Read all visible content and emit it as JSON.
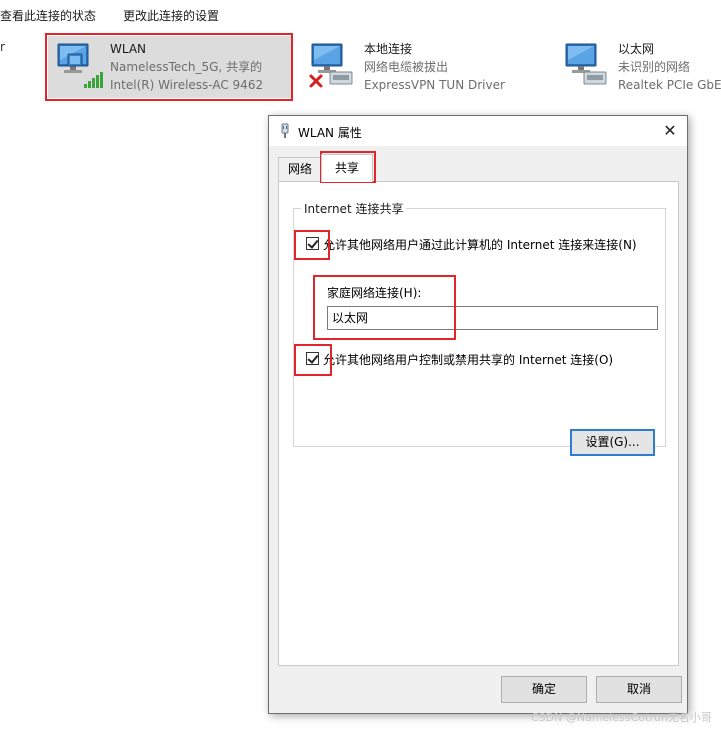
{
  "command_bar": {
    "view_status": "查看此连接的状态",
    "change_settings": "更改此连接的设置"
  },
  "left_cut_text": "r",
  "adapters": [
    {
      "name": "WLAN",
      "line1": "NamelessTech_5G, 共享的",
      "line2": "Intel(R) Wireless-AC 9462",
      "icon": "wifi-adapter-icon",
      "selected": true
    },
    {
      "name": "本地连接",
      "line1": "网络电缆被拔出",
      "line2": "ExpressVPN TUN Driver",
      "icon": "ethernet-disconnected-icon",
      "selected": false
    },
    {
      "name": "以太网",
      "line1": "未识别的网络",
      "line2": "Realtek PCIe GbE I",
      "icon": "ethernet-adapter-icon",
      "selected": false
    }
  ],
  "dialog": {
    "title": "WLAN 属性",
    "tabs": [
      {
        "label": "网络",
        "active": false
      },
      {
        "label": "共享",
        "active": true
      }
    ],
    "group_title": "Internet 连接共享",
    "allow_connect_label": "允许其他网络用户通过此计算机的 Internet 连接来连接(N)",
    "allow_connect_checked": true,
    "home_network_label": "家庭网络连接(H):",
    "home_network_value": "以太网",
    "allow_control_label": "允许其他网络用户控制或禁用共享的 Internet 连接(O)",
    "allow_control_checked": true,
    "settings_button": "设置(G)...",
    "ok_button": "确定",
    "cancel_button": "取消"
  },
  "watermark": "CSDN @NamelessCotrun无名小哥",
  "colors": {
    "annotation_red": "#e0262a",
    "focus_blue": "#2f7cd2",
    "selected_bg": "#dcdcdc",
    "dialog_bg": "#f0f0f0"
  }
}
